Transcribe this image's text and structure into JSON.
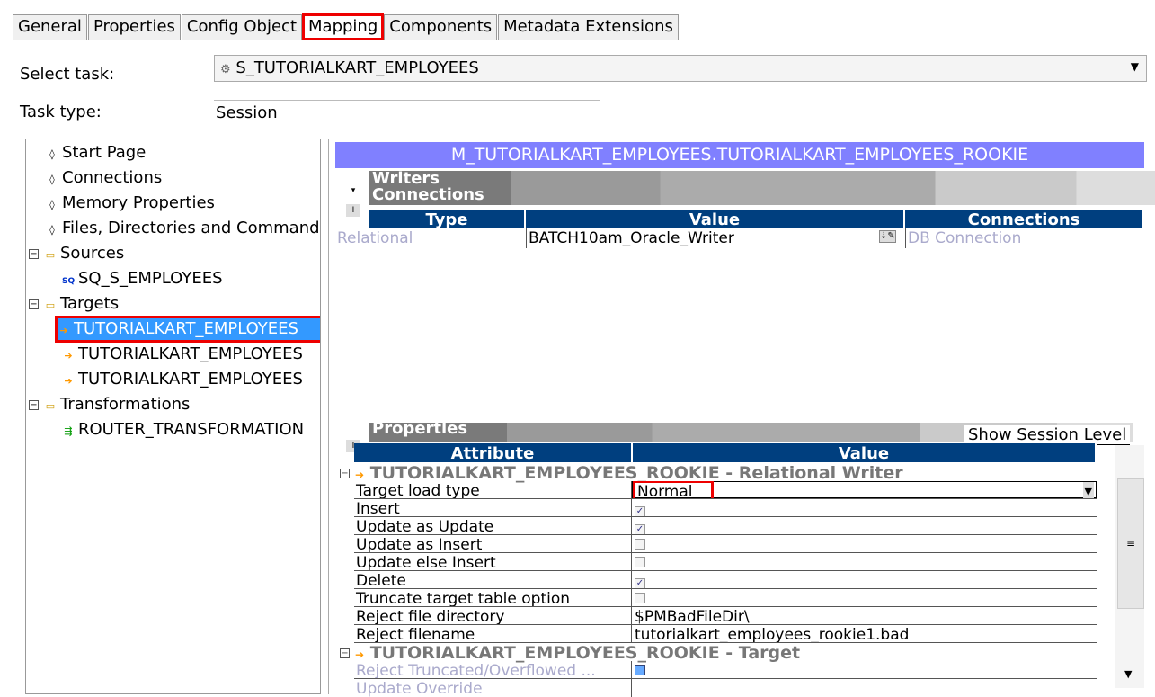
{
  "tabs": [
    {
      "label": "General"
    },
    {
      "label": "Properties"
    },
    {
      "label": "Config Object"
    },
    {
      "label": "Mapping",
      "active": true
    },
    {
      "label": "Components"
    },
    {
      "label": "Metadata Extensions"
    }
  ],
  "select_task": {
    "label": "Select task:",
    "value": "S_TUTORIALKART_EMPLOYEES"
  },
  "task_type": {
    "label": "Task type:",
    "value": "Session"
  },
  "tree": [
    {
      "label": "Start Page",
      "icon": "diamond-icon"
    },
    {
      "label": "Connections",
      "icon": "diamond-icon"
    },
    {
      "label": "Memory Properties",
      "icon": "diamond-icon"
    },
    {
      "label": "Files, Directories and Commands",
      "icon": "diamond-icon"
    },
    {
      "label": "Sources",
      "icon": "folder-icon"
    },
    {
      "label": "SQ_S_EMPLOYEES",
      "icon": "source-qualifier-icon"
    },
    {
      "label": "Targets",
      "icon": "folder-icon"
    },
    {
      "label": "TUTORIALKART_EMPLOYEES",
      "icon": "target-icon",
      "selected": true
    },
    {
      "label": "TUTORIALKART_EMPLOYEES",
      "icon": "target-icon"
    },
    {
      "label": "TUTORIALKART_EMPLOYEES",
      "icon": "target-icon"
    },
    {
      "label": "Transformations",
      "icon": "folder-icon"
    },
    {
      "label": "ROUTER_TRANSFORMATION",
      "icon": "router-icon"
    }
  ],
  "mapping_title": "M_TUTORIALKART_EMPLOYEES.TUTORIALKART_EMPLOYEES_ROOKIE",
  "writers": {
    "section1": "Writers",
    "section2": "Connections",
    "headers": [
      "Type",
      "Value",
      "Connections"
    ],
    "row": {
      "type": "Relational",
      "value": "BATCH10am_Oracle_Writer",
      "connection": "DB Connection"
    }
  },
  "properties": {
    "section": "Properties",
    "show_session_level": "Show Session Level",
    "headers": [
      "Attribute",
      "Value"
    ],
    "group1": "TUTORIALKART_EMPLOYEES_ROOKIE - Relational Writer",
    "rows": [
      {
        "attr": "Target load type",
        "value": "Normal",
        "type": "select"
      },
      {
        "attr": "Insert",
        "checked": true
      },
      {
        "attr": "Update as Update",
        "checked": true
      },
      {
        "attr": "Update as Insert",
        "checked": false
      },
      {
        "attr": "Update else Insert",
        "checked": false
      },
      {
        "attr": "Delete",
        "checked": true
      },
      {
        "attr": "Truncate target table option",
        "checked": false
      },
      {
        "attr": "Reject file directory",
        "value": "$PMBadFileDir\\"
      },
      {
        "attr": "Reject filename",
        "value": "tutorialkart_employees_rookie1.bad"
      }
    ],
    "group2": "TUTORIALKART_EMPLOYEES_ROOKIE - Target",
    "rows2": [
      {
        "attr": "Reject Truncated/Overflowed ...",
        "checked": false
      },
      {
        "attr": "Update Override",
        "value": ""
      }
    ]
  },
  "colors": {
    "title_bar": "#8080ff",
    "header": "#003f7f",
    "highlight": "#e00000",
    "selection": "#3399ff"
  }
}
